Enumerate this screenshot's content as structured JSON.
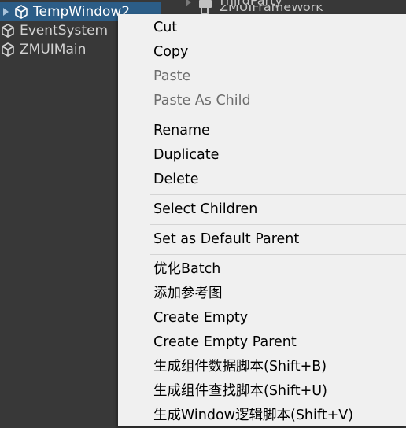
{
  "project": {
    "rows": [
      {
        "label": "ThirdParty",
        "icon": "folder-icon"
      },
      {
        "label": "ZMUIFrameWork",
        "icon": "file-icon"
      }
    ]
  },
  "hierarchy": {
    "items": [
      {
        "label": "TempWindow2",
        "selected": true,
        "icon": "gameobject-cube-icon"
      },
      {
        "label": "EventSystem",
        "selected": false,
        "icon": "gameobject-cube-icon"
      },
      {
        "label": "ZMUIMain",
        "selected": false,
        "icon": "gameobject-cube-icon"
      }
    ]
  },
  "menu": {
    "items": [
      {
        "label": "Cut",
        "enabled": true
      },
      {
        "label": "Copy",
        "enabled": true
      },
      {
        "label": "Paste",
        "enabled": false
      },
      {
        "label": "Paste As Child",
        "enabled": false
      },
      {
        "label": "Rename",
        "enabled": true
      },
      {
        "label": "Duplicate",
        "enabled": true
      },
      {
        "label": "Delete",
        "enabled": true
      },
      {
        "label": "Select Children",
        "enabled": true
      },
      {
        "label": "Set as Default Parent",
        "enabled": true
      },
      {
        "label": "优化Batch",
        "enabled": true
      },
      {
        "label": "添加参考图",
        "enabled": true
      },
      {
        "label": "Create Empty",
        "enabled": true
      },
      {
        "label": "Create Empty Parent",
        "enabled": true
      },
      {
        "label": "生成组件数据脚本(Shift+B)",
        "enabled": true
      },
      {
        "label": "生成组件查找脚本(Shift+U)",
        "enabled": true
      },
      {
        "label": "生成Window逻辑脚本(Shift+V)",
        "enabled": true
      }
    ]
  },
  "colors": {
    "panel_bg": "#383838",
    "selection_bg": "#2c5d87",
    "menu_bg": "#f0f0f0",
    "disabled_text": "#6d6d6d"
  }
}
